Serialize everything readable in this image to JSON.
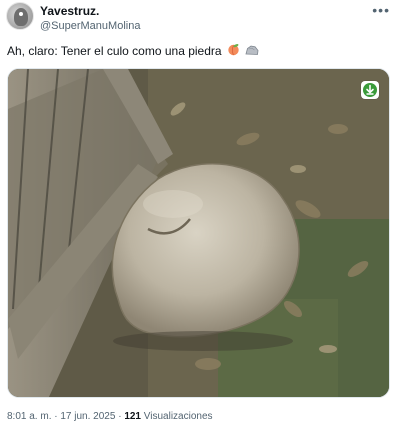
{
  "author": {
    "display_name": "Yavestruz.",
    "handle": "@SuperManuMolina"
  },
  "menu_icon": "more-horizontal-icon",
  "tweet": {
    "text": "Ah, claro: Tener el culo como una piedra",
    "emojis": [
      "peach-emoji",
      "rock-emoji"
    ]
  },
  "media": {
    "download_icon": "download-arrow-icon"
  },
  "meta": {
    "time": "8:01 a. m.",
    "separator1": " · ",
    "date": "17 jun. 2025",
    "separator2": " · ",
    "view_count": "121",
    "views_label": "Visualizaciones"
  }
}
